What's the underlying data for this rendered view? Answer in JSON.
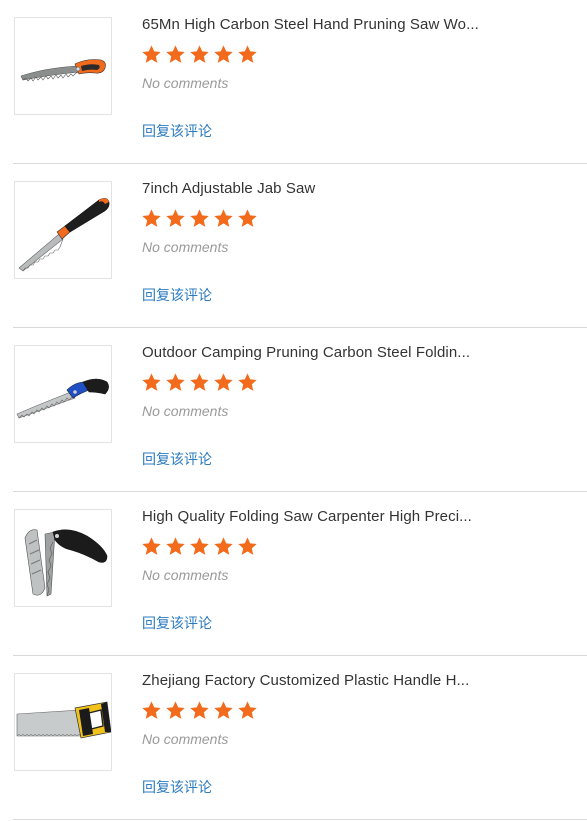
{
  "colors": {
    "star": "#f26a1b",
    "reply_link": "#2b7bc0",
    "title_text": "#333333",
    "muted_text": "#9a9a9a",
    "divider": "#d9d9d9"
  },
  "items": [
    {
      "title": "65Mn High Carbon Steel Hand Pruning Saw Wo...",
      "rating": 5,
      "comments": "No comments",
      "reply_label": "回复该评论",
      "image_icon": "pruning-saw-image"
    },
    {
      "title": "7inch Adjustable Jab Saw",
      "rating": 5,
      "comments": "No comments",
      "reply_label": "回复该评论",
      "image_icon": "jab-saw-image"
    },
    {
      "title": "Outdoor Camping Pruning Carbon Steel Foldin...",
      "rating": 5,
      "comments": "No comments",
      "reply_label": "回复该评论",
      "image_icon": "camping-saw-image"
    },
    {
      "title": "High Quality Folding Saw Carpenter High Preci...",
      "rating": 5,
      "comments": "No comments",
      "reply_label": "回复该评论",
      "image_icon": "folding-saw-image"
    },
    {
      "title": "Zhejiang Factory Customized Plastic Handle H...",
      "rating": 5,
      "comments": "No comments",
      "reply_label": "回复该评论",
      "image_icon": "hand-saw-image"
    }
  ]
}
